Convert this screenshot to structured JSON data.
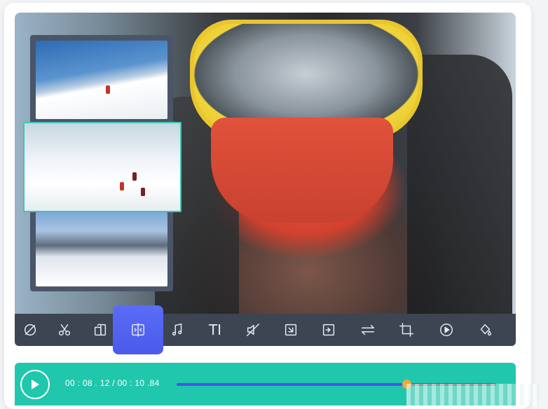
{
  "toolbar": {
    "tools": [
      {
        "icon": "hide-icon"
      },
      {
        "icon": "scissors-icon"
      },
      {
        "icon": "rotate-icon"
      },
      {
        "icon": "split-icon"
      },
      {
        "icon": "music-icon"
      },
      {
        "icon": "text-icon",
        "glyph": "TI"
      },
      {
        "icon": "mute-icon"
      },
      {
        "icon": "resize-icon"
      },
      {
        "icon": "export-icon"
      },
      {
        "icon": "swap-icon"
      },
      {
        "icon": "crop-icon"
      },
      {
        "icon": "play-circle-icon"
      },
      {
        "icon": "fill-icon"
      }
    ],
    "active_index": 3,
    "active_color": "#4a5bec"
  },
  "player": {
    "current_time": "00 : 08 . 12",
    "total_time": "00 : 10 .84",
    "time_separator": " / ",
    "progress": 0.72,
    "accent_color": "#21c7ad",
    "knob_color": "#f2a636",
    "fill_color": "#4656e8"
  }
}
